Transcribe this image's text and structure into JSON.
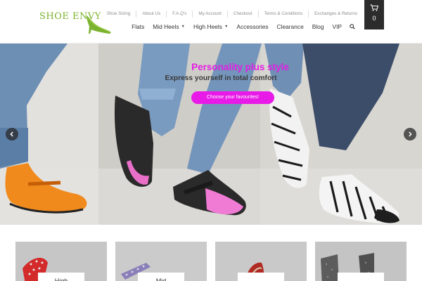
{
  "brand": {
    "name": "SHOE ENVY",
    "accent": "#7bb32e"
  },
  "top_links": [
    "Shoe Sizing",
    "About Us",
    "F.A.Q's",
    "My Account",
    "Checkout",
    "Terms & Conditions",
    "Exchanges & Returns"
  ],
  "main_nav": [
    {
      "label": "Flats",
      "has_dropdown": false
    },
    {
      "label": "Mid Heels",
      "has_dropdown": true
    },
    {
      "label": "High Heels",
      "has_dropdown": true
    },
    {
      "label": "Accessories",
      "has_dropdown": false
    },
    {
      "label": "Clearance",
      "has_dropdown": false
    },
    {
      "label": "Blog",
      "has_dropdown": false
    },
    {
      "label": "VIP",
      "has_dropdown": false
    }
  ],
  "nav_icons": {
    "search": "search-icon",
    "cart": "cart-icon",
    "dropdown": "chevron-down-icon"
  },
  "cart": {
    "count": "0"
  },
  "hero": {
    "title": "Personality plus style",
    "subtitle": "Express yourself in total comfort",
    "cta": "Choose your favourites!",
    "title_color": "#e31ee3",
    "cta_color": "#e81ae8",
    "prev_icon": "chevron-left-icon",
    "next_icon": "chevron-right-icon"
  },
  "categories": [
    {
      "label": "High"
    },
    {
      "label": "Mid"
    },
    {
      "label": ""
    },
    {
      "label": ""
    }
  ]
}
